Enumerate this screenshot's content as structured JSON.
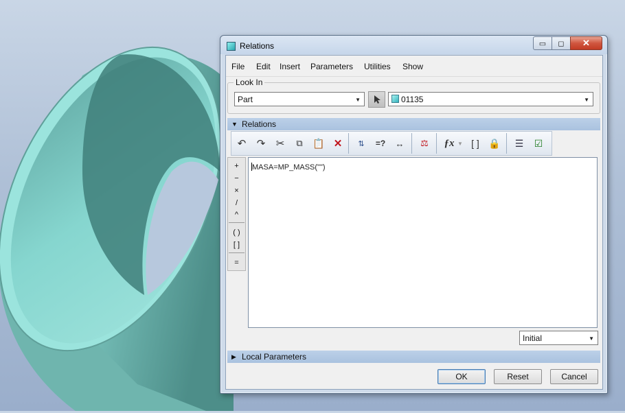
{
  "window": {
    "title": "Relations"
  },
  "titlebar_buttons": {
    "minimize": "▭",
    "maximize": "◻",
    "close": "✕"
  },
  "menu": [
    "File",
    "Edit",
    "Insert",
    "Parameters",
    "Utilities",
    "Show"
  ],
  "look_in": {
    "legend": "Look In",
    "type_value": "Part",
    "model_value": "01135"
  },
  "relations_section": {
    "label": "Relations"
  },
  "toolbar_icons": [
    "undo-icon",
    "redo-icon",
    "cut-icon",
    "copy-icon",
    "paste-icon",
    "delete-icon",
    "sort-relations-icon",
    "evaluate-icon",
    "dimension-display-icon",
    "verify-units-icon",
    "function-icon",
    "array-brackets-icon",
    "lock-icon",
    "local-parameters-icon",
    "verify-relations-icon"
  ],
  "operators": {
    "plus": "+",
    "minus": "−",
    "times": "×",
    "divide": "/",
    "power": "^",
    "parens": "( )",
    "brackets": "[ ]",
    "equals": "="
  },
  "editor": {
    "text": "MASA=MP_MASS(\"\")"
  },
  "sort_select": {
    "value": "Initial"
  },
  "local_parameters_section": {
    "label": "Local Parameters"
  },
  "buttons": {
    "ok": "OK",
    "reset": "Reset",
    "cancel": "Cancel"
  },
  "colors": {
    "model_teal": "#7fcfc9",
    "section_header": "#b4cae4",
    "window_frame": "#cfdbea"
  }
}
